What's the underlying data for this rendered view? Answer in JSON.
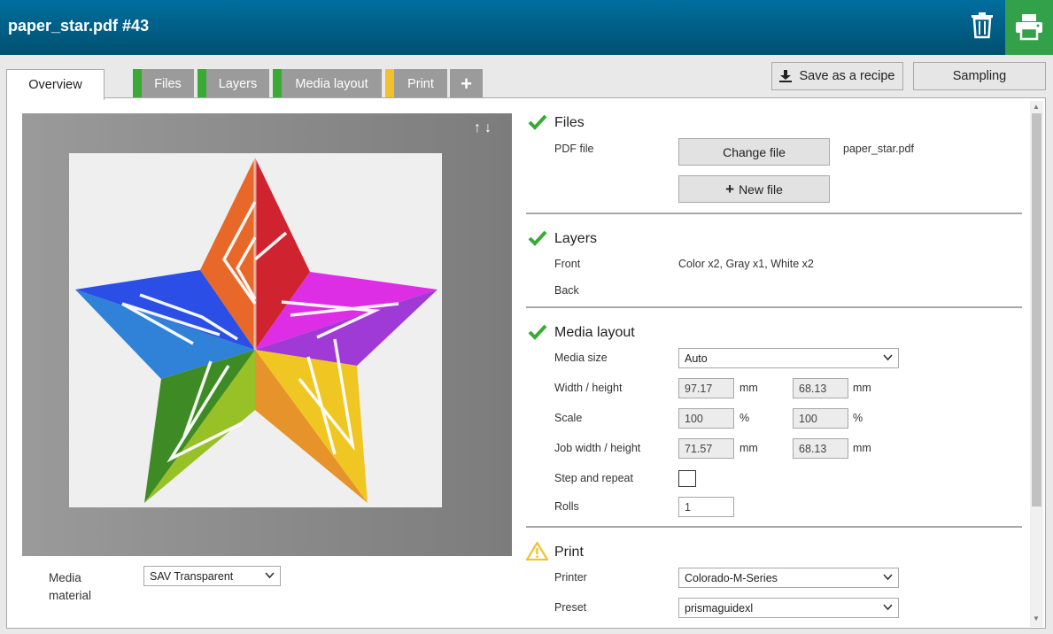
{
  "header": {
    "title": "paper_star.pdf #43",
    "trash_icon": "trash-icon",
    "print_icon": "printer-icon",
    "print_color": "#33a14a"
  },
  "tabs": {
    "overview": "Overview",
    "files": "Files",
    "layers": "Layers",
    "media_layout": "Media layout",
    "print": "Print",
    "add": "+"
  },
  "toolbar": {
    "save_recipe": "Save as a recipe",
    "sampling": "Sampling"
  },
  "preview": {
    "arrows": "↑↓",
    "media_material_label": "Media material",
    "media_material_value": "SAV Transparent"
  },
  "files": {
    "title": "Files",
    "pdf_label": "PDF file",
    "change_file": "Change file",
    "new_file": "New file",
    "file_name": "paper_star.pdf"
  },
  "layers": {
    "title": "Layers",
    "front_label": "Front",
    "front_value": "Color x2, Gray x1, White x2",
    "back_label": "Back"
  },
  "media_layout": {
    "title": "Media layout",
    "media_size_label": "Media size",
    "media_size_value": "Auto",
    "wh_label": "Width / height",
    "width": "97.17",
    "height": "68.13",
    "scale_label": "Scale",
    "scale_x": "100",
    "scale_y": "100",
    "job_wh_label": "Job width / height",
    "job_width": "71.57",
    "job_height": "68.13",
    "step_label": "Step and repeat",
    "rolls_label": "Rolls",
    "rolls_value": "1",
    "unit_mm": "mm",
    "unit_pct": "%"
  },
  "print": {
    "title": "Print",
    "printer_label": "Printer",
    "printer_value": "Colorado-M-Series",
    "preset_label": "Preset",
    "preset_value": "prismaguidexl"
  },
  "colors": {
    "ok": "#3aaa35",
    "warn": "#f2c12e",
    "header": "#00608a"
  }
}
